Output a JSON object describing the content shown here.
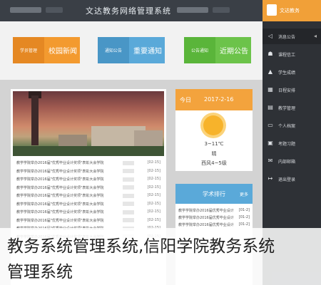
{
  "header": {
    "title": "文达教务网络管理系统"
  },
  "tiles": [
    {
      "side": "学员管理",
      "label": "校园新闻",
      "color": "#f39a2f",
      "side_color": "#e58823"
    },
    {
      "side": "通知公告",
      "label": "重要通知",
      "color": "#5aa9d9",
      "side_color": "#4995c5"
    },
    {
      "side": "公告通知",
      "label": "近期公告",
      "color": "#6cc34a",
      "side_color": "#5ab53a"
    }
  ],
  "weather": {
    "today": "今日",
    "date": "2017-2-16",
    "temp": "3~11℃",
    "cond": "晴",
    "wind": "西风4~5级"
  },
  "notice": {
    "title": "学术排行",
    "more": "更多"
  },
  "news": [
    {
      "text": "教学学院举办2016届\"优秀毕业设计奖项\"表彰大会学院",
      "date": "[02-15]"
    },
    {
      "text": "教学学院举办2016届\"优秀毕业设计奖项\"表彰大会学院",
      "date": "[02-15]"
    },
    {
      "text": "教学学院举办2016届\"优秀毕业设计奖项\"表彰大会学院",
      "date": "[02-15]"
    },
    {
      "text": "教学学院举办2016届\"优秀毕业设计奖项\"表彰大会学院",
      "date": "[02-15]"
    },
    {
      "text": "教学学院举办2016届\"优秀毕业设计奖项\"表彰大会学院",
      "date": "[02-15]"
    },
    {
      "text": "教学学院举办2016届\"优秀毕业设计奖项\"表彰大会学院",
      "date": "[02-15]"
    },
    {
      "text": "教学学院举办2016届\"优秀毕业设计奖项\"表彰大会学院",
      "date": "[02-15]"
    },
    {
      "text": "教学学院举办2016届\"优秀毕业设计奖项\"表彰大会学院",
      "date": "[02-15]"
    },
    {
      "text": "教学学院举办2016届\"优秀毕业设计奖项\"表彰大会学院",
      "date": "[02-15]"
    },
    {
      "text": "教学学院举办2016届\"优秀毕业设计奖项\"表彰大会学院",
      "date": "[02-15]"
    }
  ],
  "notice_rows": [
    {
      "text": "教学学院举办2016届优秀毕业设计",
      "date": "[01-2]"
    },
    {
      "text": "教学学院举办2016届优秀毕业设计",
      "date": "[01-2]"
    },
    {
      "text": "教学学院举办2016届优秀毕业设计",
      "date": "[01-2]"
    }
  ],
  "sidebar": {
    "brand": "文达教务",
    "items": [
      {
        "label": "消息公告",
        "icon": "speaker-icon"
      },
      {
        "label": "课程信工",
        "icon": "user-icon"
      },
      {
        "label": "学生成绩",
        "icon": "graduation-icon"
      },
      {
        "label": "日程安排",
        "icon": "calendar-icon"
      },
      {
        "label": "教学管理",
        "icon": "clipboard-icon"
      },
      {
        "label": "个人档案",
        "icon": "document-icon"
      },
      {
        "label": "考题习题",
        "icon": "monitor-icon"
      },
      {
        "label": "内部邮箱",
        "icon": "mail-icon"
      },
      {
        "label": "退出登录",
        "icon": "logout-icon"
      }
    ]
  },
  "caption": {
    "line1": "教务系统管理系统,信阳学院教务系统",
    "line2": "管理系统"
  }
}
